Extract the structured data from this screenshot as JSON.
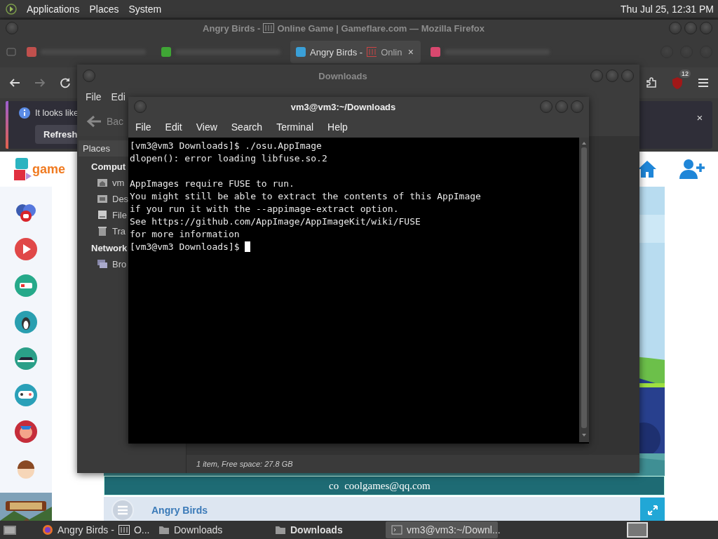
{
  "top_panel": {
    "menus": [
      "Applications",
      "Places",
      "System"
    ],
    "clock": "Thu Jul 25, 12:31 PM"
  },
  "firefox": {
    "title_start": "Angry Birds -",
    "title_end": "Online Game | Gameflare.com — Mozilla Firefox",
    "tabs": [
      {
        "selected": false,
        "color": "#c0504d"
      },
      {
        "selected": false,
        "color": "#3fa535"
      },
      {
        "selected": true,
        "color": "#3aa0d8",
        "label": "Angry Birds -",
        "label_end": "Onlin",
        "close": "×"
      },
      {
        "selected": false,
        "color": "#d9486f"
      }
    ],
    "extension_badge": "12",
    "notification": {
      "message": "It looks like",
      "button": "Refresh",
      "close": "×"
    },
    "page": {
      "logo_text": "game",
      "email_start": "co",
      "email": "coolgames@qq.com",
      "game_title": "Angry Birds"
    }
  },
  "file_manager": {
    "title": "Downloads",
    "menus": [
      "File",
      "Edi"
    ],
    "back": "Bac",
    "places": "Places",
    "sections": [
      {
        "heading": "Comput",
        "items": [
          {
            "kind": "home",
            "label": "vm"
          },
          {
            "kind": "desktop",
            "label": "Des"
          },
          {
            "kind": "disk",
            "label": "File"
          },
          {
            "kind": "trash",
            "label": "Tra"
          }
        ]
      },
      {
        "heading": "Network",
        "items": [
          {
            "kind": "network",
            "label": "Bro"
          }
        ]
      }
    ],
    "status": "1 item, Free space: 27.8 GB"
  },
  "terminal": {
    "title": "vm3@vm3:~/Downloads",
    "menus": [
      "File",
      "Edit",
      "View",
      "Search",
      "Terminal",
      "Help"
    ],
    "blocks": [
      [
        "[vm3@vm3 Downloads]$ ./osu.AppImage",
        "dlopen(): error loading libfuse.so.2"
      ],
      [
        "AppImages require FUSE to run.",
        "You might still be able to extract the contents of this AppImage",
        "if you run it with the --appimage-extract option.",
        "See https://github.com/AppImage/AppImageKit/wiki/FUSE",
        "for more information",
        "[vm3@vm3 Downloads]$ "
      ]
    ],
    "cursor": true
  },
  "taskbar": {
    "items": [
      {
        "kind": "browser",
        "label": "Angry Birds -",
        "label_end": "O...",
        "selected": false,
        "emphasized": false
      },
      {
        "kind": "folder",
        "label": "Downloads",
        "selected": false,
        "emphasized": false
      },
      {
        "kind": "folder",
        "label": "Downloads",
        "selected": false,
        "emphasized": true
      },
      {
        "kind": "terminal",
        "label": "vm3@vm3:~/Downl...",
        "selected": true,
        "emphasized": false
      }
    ]
  }
}
